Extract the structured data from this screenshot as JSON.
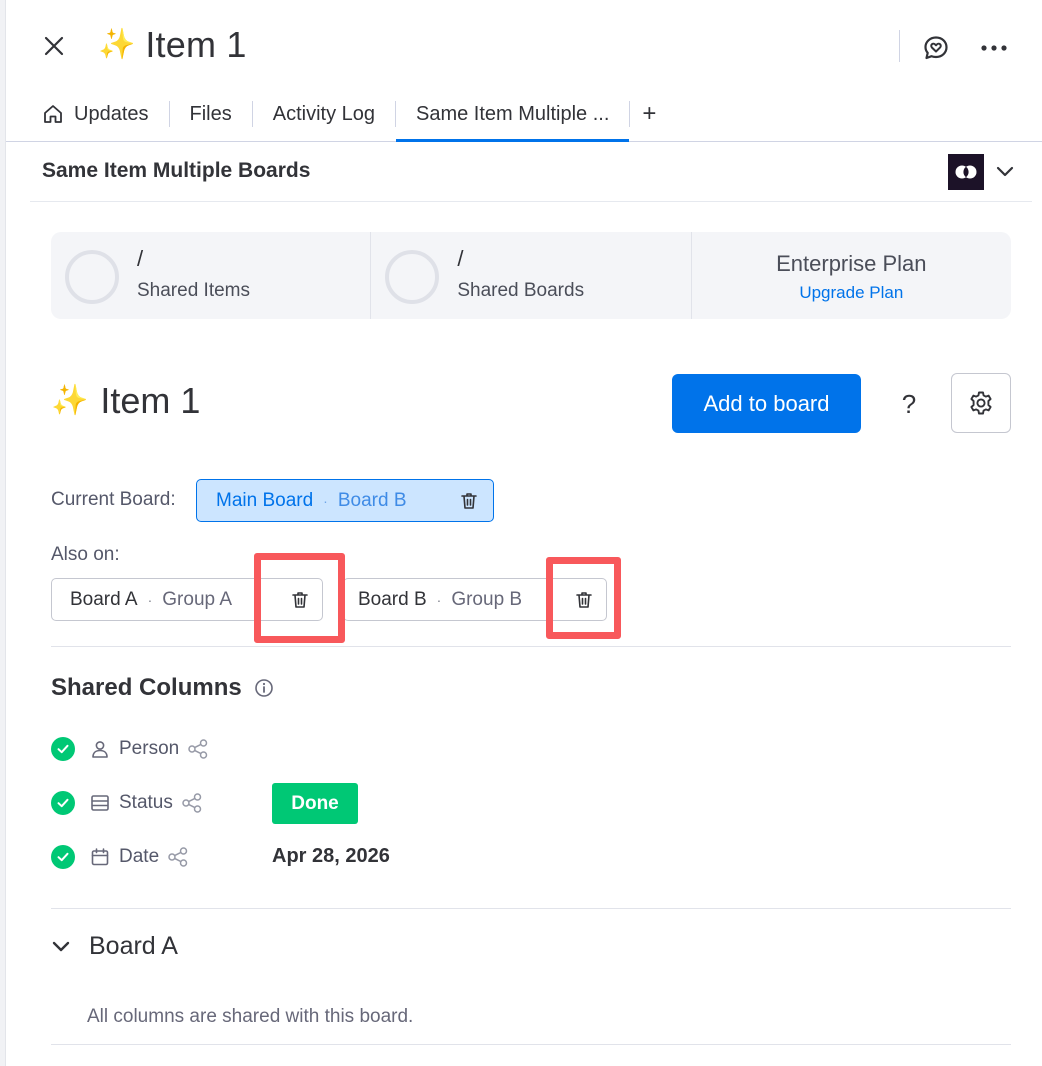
{
  "header": {
    "sparkle_icon": "✨",
    "title": "Item 1"
  },
  "tabs": [
    {
      "label": "Updates",
      "icon": "home-icon"
    },
    {
      "label": "Files"
    },
    {
      "label": "Activity Log"
    },
    {
      "label": "Same Item Multiple ...",
      "active": true
    }
  ],
  "tab_add_label": "+",
  "app": {
    "title": "Same Item Multiple Boards"
  },
  "stats": {
    "shared_items": {
      "value": "/",
      "label": "Shared Items"
    },
    "shared_boards": {
      "value": "/",
      "label": "Shared Boards"
    },
    "plan": {
      "name": "Enterprise Plan",
      "link": "Upgrade Plan"
    }
  },
  "item": {
    "sparkle_icon": "✨",
    "name": "Item 1",
    "add_button": "Add to board",
    "help_label": "?"
  },
  "current_board": {
    "label": "Current Board:",
    "board": "Main Board",
    "separator": "·",
    "group": "Board B"
  },
  "also_on": {
    "label": "Also on:",
    "boards": [
      {
        "board": "Board A",
        "separator": "·",
        "group": "Group A"
      },
      {
        "board": "Board B",
        "separator": "·",
        "group": "Group B"
      }
    ]
  },
  "shared_columns": {
    "title": "Shared Columns",
    "columns": [
      {
        "name": "Person",
        "icon": "person-icon"
      },
      {
        "name": "Status",
        "icon": "status-icon",
        "value": "Done"
      },
      {
        "name": "Date",
        "icon": "calendar-icon",
        "value": "Apr 28, 2026"
      }
    ]
  },
  "board_a": {
    "title": "Board A",
    "note": "All columns are shared with this board."
  },
  "colors": {
    "primary": "#0073ea",
    "done_green": "#00c875",
    "highlight_red": "#f8585b",
    "current_chip_bg": "#cce5ff"
  }
}
